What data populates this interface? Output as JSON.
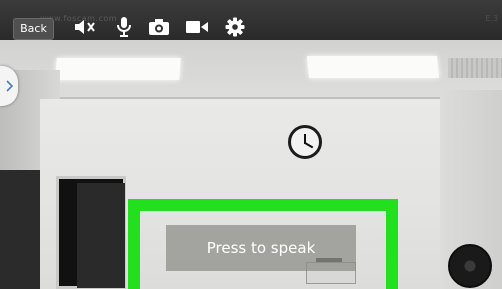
{
  "toolbar": {
    "back_label": "Back",
    "watermark": "www.foscam.com",
    "watermark_right": "E.3",
    "icons": [
      "speaker-muted-icon",
      "microphone-icon",
      "camera-icon",
      "video-camera-icon",
      "settings-gear-icon"
    ]
  },
  "side_panel": {
    "icon": "chevron-right-icon"
  },
  "talk": {
    "label": "Press to speak",
    "highlight_color": "#22e01e"
  },
  "colors": {
    "toolbar_bg": "#2f2f2f",
    "icon_color": "#ffffff"
  }
}
